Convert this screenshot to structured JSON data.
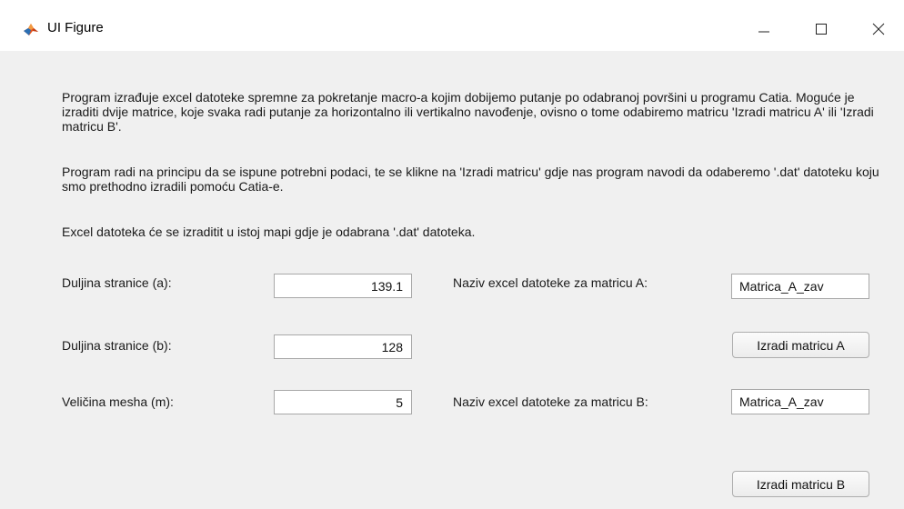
{
  "window": {
    "title": "UI Figure",
    "icon": "matlab-logo-icon",
    "controls": {
      "minimize": "—",
      "maximize": "☐",
      "close": "✕"
    }
  },
  "description": {
    "paragraph1": "Program izrađuje excel datoteke spremne za pokretanje macro-a kojim dobijemo putanje po odabranoj površini u programu Catia. Moguće je izraditi dvije matrice, koje svaka radi putanje za horizontalno ili vertikalno navođenje, ovisno o tome odabiremo matricu 'Izradi matricu A' ili 'Izradi matricu B'.",
    "paragraph2": "Program radi na principu da se ispune potrebni podaci, te se klikne na 'Izradi matricu' gdje nas program navodi da odaberemo '.dat' datoteku koju smo prethodno izradili pomoću Catia-e.",
    "paragraph3": "Excel datoteka će se izraditit u istoj mapi gdje je odabrana '.dat' datoteka."
  },
  "inputs": {
    "side_a": {
      "label": "Duljina stranice (a):",
      "value": "139.1"
    },
    "side_b": {
      "label": "Duljina stranice (b):",
      "value": "128"
    },
    "mesh_size": {
      "label": "Veličina mesha (m):",
      "value": "5"
    }
  },
  "outputs": {
    "file_a": {
      "label": "Naziv excel datoteke za matricu A:",
      "value": "Matrica_A_zav"
    },
    "file_b": {
      "label": "Naziv excel datoteke za matricu B:",
      "value": "Matrica_A_zav"
    },
    "button_a": "Izradi matricu A",
    "button_b": "Izradi matricu B"
  }
}
